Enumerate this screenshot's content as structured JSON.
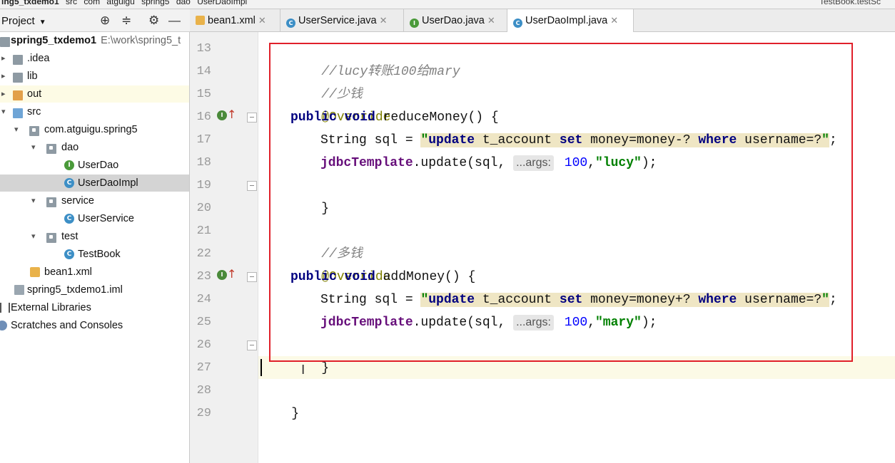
{
  "breadcrumb": {
    "items": [
      "ing5_txdemo1",
      "src",
      "com",
      "atguigu",
      "spring5",
      "dao",
      "UserDaoImpl"
    ],
    "right": "TestBook.testSc"
  },
  "project_panel": {
    "title": "Project",
    "tree": [
      {
        "label": "spring5_txdemo1",
        "path": "E:\\work\\spring5_t",
        "icon": "module-folder-icon"
      },
      {
        "label": ".idea",
        "icon": "folder-icon"
      },
      {
        "label": "lib",
        "icon": "folder-icon"
      },
      {
        "label": "out",
        "icon": "folder-orange-icon"
      },
      {
        "label": "src",
        "icon": "source-folder-icon"
      },
      {
        "label": "com.atguigu.spring5",
        "icon": "package-icon"
      },
      {
        "label": "dao",
        "icon": "package-icon"
      },
      {
        "label": "UserDao",
        "icon": "interface-icon",
        "badge": "I"
      },
      {
        "label": "UserDaoImpl",
        "icon": "class-icon",
        "badge": "C"
      },
      {
        "label": "service",
        "icon": "package-icon"
      },
      {
        "label": "UserService",
        "icon": "class-icon",
        "badge": "C"
      },
      {
        "label": "test",
        "icon": "package-icon"
      },
      {
        "label": "TestBook",
        "icon": "class-icon",
        "badge": "C"
      },
      {
        "label": "bean1.xml",
        "icon": "xml-file-icon"
      },
      {
        "label": "spring5_txdemo1.iml",
        "icon": "iml-file-icon"
      },
      {
        "label": "External Libraries",
        "icon": "libraries-icon"
      },
      {
        "label": "Scratches and Consoles",
        "icon": "scratches-icon"
      }
    ]
  },
  "tabs": [
    {
      "label": "bean1.xml",
      "badge": "x"
    },
    {
      "label": "UserService.java",
      "badge": "C"
    },
    {
      "label": "UserDao.java",
      "badge": "I"
    },
    {
      "label": "UserDaoImpl.java",
      "badge": "C"
    }
  ],
  "editor": {
    "line_numbers": [
      "13",
      "14",
      "15",
      "16",
      "17",
      "18",
      "19",
      "20",
      "21",
      "22",
      "23",
      "24",
      "25",
      "26",
      "27",
      "28",
      "29"
    ],
    "code": {
      "l13": "//lucy转账100给mary",
      "l14": "//少钱",
      "l15": "@Override",
      "l16_kw": "public void",
      "l16_rest": " reduceMoney() {",
      "l17_pre": "String sql = ",
      "l17_q1": "\"",
      "l17_k1": "update",
      "l17_m1": " t_account ",
      "l17_k2": "set",
      "l17_m2": " money=money-? ",
      "l17_k3": "where",
      "l17_m3": " username=?",
      "l17_q2": "\"",
      "l17_end": ";",
      "l18_fld": "jdbcTemplate",
      "l18_mid": ".update(sql, ",
      "l18_hint": "...args:",
      "l18_num": " 100",
      "l18_comma": ",",
      "l18_str": "\"lucy\"",
      "l18_end": ");",
      "l19": "}",
      "l21": "//多钱",
      "l22": "@Override",
      "l23_kw": "public void",
      "l23_rest": " addMoney() {",
      "l24_pre": "String sql = ",
      "l24_q1": "\"",
      "l24_k1": "update",
      "l24_m1": " t_account ",
      "l24_k2": "set",
      "l24_m2": " money=money+? ",
      "l24_k3": "where",
      "l24_m3": " username=?",
      "l24_q2": "\"",
      "l24_end": ";",
      "l25_fld": "jdbcTemplate",
      "l25_mid": ".update(sql, ",
      "l25_hint": "...args:",
      "l25_num": " 100",
      "l25_comma": ",",
      "l25_str": "\"mary\"",
      "l25_end": ");",
      "l26": "}",
      "l28": "}"
    },
    "override_marker_badge": "I"
  },
  "colors": {
    "annotation_box": "#e0202a",
    "keyword": "#000080",
    "string": "#008000",
    "comment": "#808080",
    "annotation": "#808000",
    "field": "#660e7a",
    "number": "#0000ff"
  }
}
